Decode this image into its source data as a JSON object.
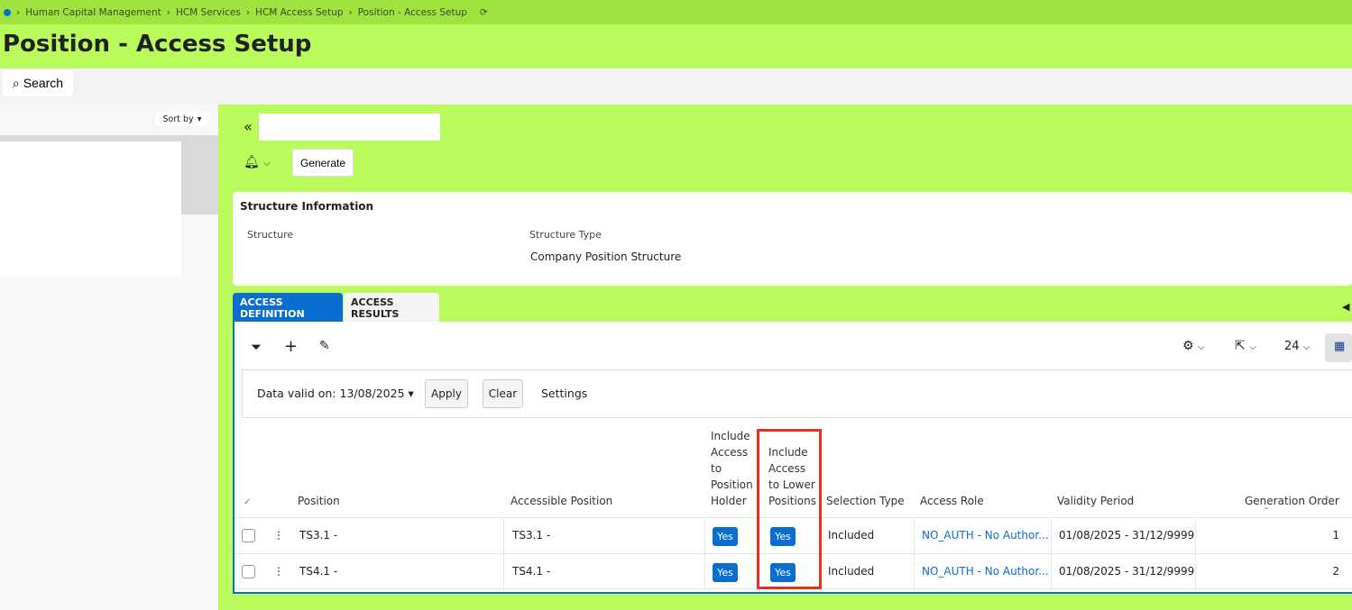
{
  "breadcrumb": [
    "Human Capital Management",
    "HCM Services",
    "HCM Access Setup",
    "Position - Access Setup"
  ],
  "page_title": "Position - Access Setup",
  "search_label": "Search",
  "sort_by_label": "Sort by",
  "generate_label": "Generate",
  "structure": {
    "heading": "Structure Information",
    "structure_label": "Structure",
    "structure_type_label": "Structure Type",
    "structure_type_value": "Company Position Structure"
  },
  "tabs": [
    {
      "label": "ACCESS DEFINITION",
      "active": true
    },
    {
      "label": "ACCESS RESULTS",
      "active": false
    }
  ],
  "toolbar": {
    "page_size": "24"
  },
  "filter": {
    "data_valid_on": "Data valid on: 13/08/2025",
    "apply": "Apply",
    "clear": "Clear",
    "settings": "Settings"
  },
  "columns": [
    "Position",
    "Accessible Position",
    "Include Access to Position Holder",
    "Include Access to Lower Positions",
    "Selection Type",
    "Access Role",
    "Validity Period",
    "Generation Order"
  ],
  "rows": [
    {
      "position": "TS3.1 -",
      "accessible": "TS3.1 -",
      "holder": "Yes",
      "lower": "Yes",
      "selection": "Included",
      "role": "NO_AUTH - No Author...",
      "validity": "01/08/2025 - 31/12/9999",
      "order": "1"
    },
    {
      "position": "TS4.1 -",
      "accessible": "TS4.1 -",
      "holder": "Yes",
      "lower": "Yes",
      "selection": "Included",
      "role": "NO_AUTH - No Author...",
      "validity": "01/08/2025 - 31/12/9999",
      "order": "2"
    }
  ],
  "colors": {
    "accent": "#0a6ed1",
    "highlight": "#e8321e",
    "background": "#b8fb5a"
  }
}
